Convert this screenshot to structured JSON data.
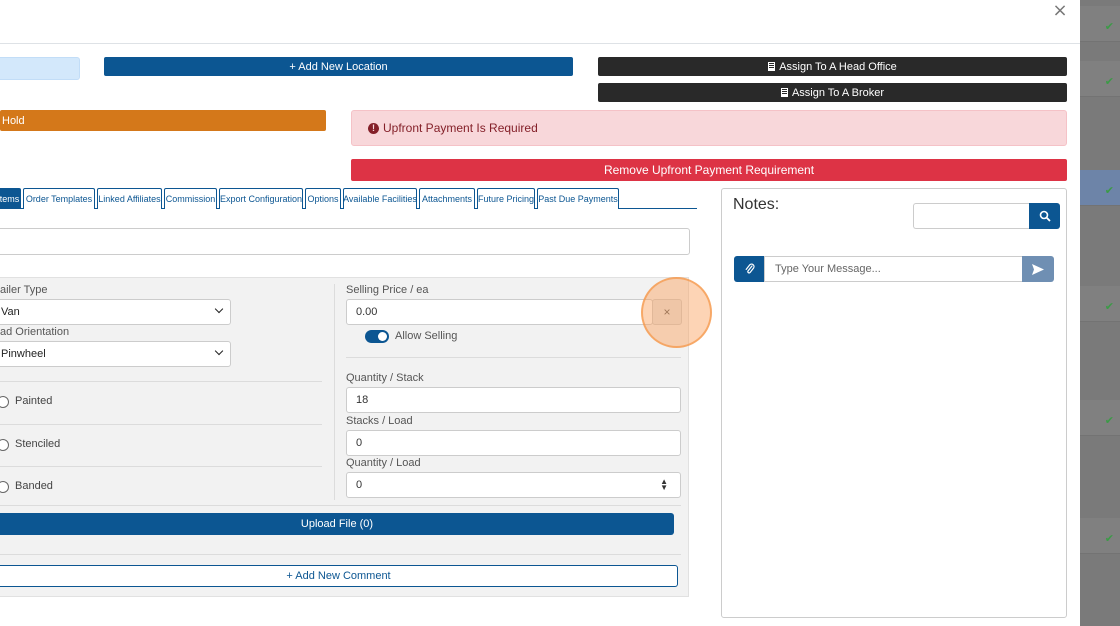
{
  "toolbar": {
    "add_location_label": "+ Add New Location",
    "assign_head_office_label": "Assign To A Head Office",
    "assign_broker_label": "Assign To A Broker",
    "hold_label": "Hold",
    "remove_upfront_label": "Remove Upfront Payment Requirement"
  },
  "alert": {
    "text": "Upfront Payment Is Required",
    "icon": "exclamation-circle-icon"
  },
  "tabs": [
    {
      "label": "tems",
      "active": true
    },
    {
      "label": "Order Templates",
      "active": false
    },
    {
      "label": "Linked Affiliates",
      "active": false
    },
    {
      "label": "Commission",
      "active": false
    },
    {
      "label": "Export Configuration",
      "active": false
    },
    {
      "label": "Options",
      "active": false
    },
    {
      "label": "Available Facilities",
      "active": false
    },
    {
      "label": "Attachments",
      "active": false
    },
    {
      "label": "Future Pricing",
      "active": false
    },
    {
      "label": "Past Due Payments",
      "active": false
    }
  ],
  "form": {
    "trailer_type_label": "ailer Type",
    "trailer_type_value": "Van",
    "load_orientation_label": "ad Orientation",
    "load_orientation_value": "Pinwheel",
    "painted_label": "Painted",
    "stenciled_label": "Stenciled",
    "banded_label": "Banded",
    "selling_price_label": "Selling Price / ea",
    "selling_price_value": "0.00",
    "clear_label": "×",
    "allow_selling_label": "Allow Selling",
    "quantity_stack_label": "Quantity / Stack",
    "quantity_stack_value": "18",
    "stacks_load_label": "Stacks / Load",
    "stacks_load_value": "0",
    "quantity_load_label": "Quantity / Load",
    "quantity_load_value": "0",
    "upload_label": "Upload File (0)",
    "add_comment_label": "+ Add New Comment"
  },
  "notes": {
    "title": "Notes:",
    "message_placeholder": "Type Your Message..."
  },
  "colors": {
    "primary": "#0c5692",
    "dark": "#292929",
    "warning": "#d4781a",
    "danger": "#dd3345",
    "alert_bg": "#f8d7da"
  }
}
